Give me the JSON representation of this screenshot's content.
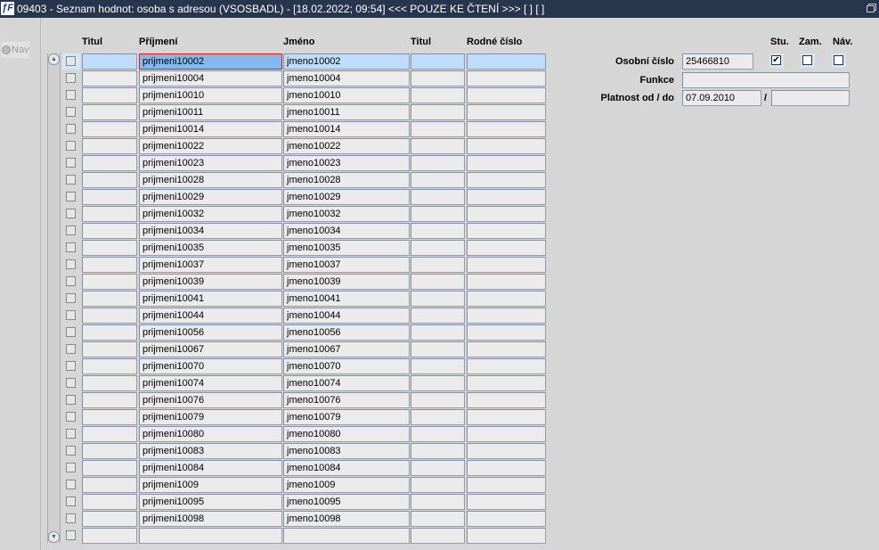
{
  "window": {
    "title": "09403 - Seznam hodnot: osoba s adresou (VSOSBADL) - [18.02.2022; 09:54] <<< POUZE KE ČTENÍ >>>  [ ]  [ ]",
    "logo": "IF"
  },
  "nav": {
    "label": "Nav"
  },
  "table": {
    "headers": [
      "Titul",
      "Příjmení",
      "Jméno",
      "Titul",
      "Rodné číslo"
    ],
    "rows": [
      {
        "prijmeni": "prijmeni10002",
        "jmeno": "jmeno10002"
      },
      {
        "prijmeni": "prijmeni10004",
        "jmeno": "jmeno10004"
      },
      {
        "prijmeni": "prijmeni10010",
        "jmeno": "jmeno10010"
      },
      {
        "prijmeni": "prijmeni10011",
        "jmeno": "jmeno10011"
      },
      {
        "prijmeni": "prijmeni10014",
        "jmeno": "jmeno10014"
      },
      {
        "prijmeni": "prijmeni10022",
        "jmeno": "jmeno10022"
      },
      {
        "prijmeni": "prijmeni10023",
        "jmeno": "jmeno10023"
      },
      {
        "prijmeni": "prijmeni10028",
        "jmeno": "jmeno10028"
      },
      {
        "prijmeni": "prijmeni10029",
        "jmeno": "jmeno10029"
      },
      {
        "prijmeni": "prijmeni10032",
        "jmeno": "jmeno10032"
      },
      {
        "prijmeni": "prijmeni10034",
        "jmeno": "jmeno10034"
      },
      {
        "prijmeni": "prijmeni10035",
        "jmeno": "jmeno10035"
      },
      {
        "prijmeni": "prijmeni10037",
        "jmeno": "jmeno10037"
      },
      {
        "prijmeni": "prijmeni10039",
        "jmeno": "jmeno10039"
      },
      {
        "prijmeni": "prijmeni10041",
        "jmeno": "jmeno10041"
      },
      {
        "prijmeni": "prijmeni10044",
        "jmeno": "jmeno10044"
      },
      {
        "prijmeni": "prijmeni10056",
        "jmeno": "jmeno10056"
      },
      {
        "prijmeni": "prijmeni10067",
        "jmeno": "jmeno10067"
      },
      {
        "prijmeni": "prijmeni10070",
        "jmeno": "jmeno10070"
      },
      {
        "prijmeni": "prijmeni10074",
        "jmeno": "jmeno10074"
      },
      {
        "prijmeni": "prijmeni10076",
        "jmeno": "jmeno10076"
      },
      {
        "prijmeni": "prijmeni10079",
        "jmeno": "jmeno10079"
      },
      {
        "prijmeni": "prijmeni10080",
        "jmeno": "jmeno10080"
      },
      {
        "prijmeni": "prijmeni10083",
        "jmeno": "jmeno10083"
      },
      {
        "prijmeni": "prijmeni10084",
        "jmeno": "jmeno10084"
      },
      {
        "prijmeni": "prijmeni1009",
        "jmeno": "jmeno1009"
      },
      {
        "prijmeni": "prijmeni10095",
        "jmeno": "jmeno10095"
      },
      {
        "prijmeni": "prijmeni10098",
        "jmeno": "jmeno10098"
      },
      {
        "prijmeni": "",
        "jmeno": ""
      }
    ]
  },
  "detail": {
    "osobni_cislo_label": "Osobní číslo",
    "osobni_cislo": "25466810",
    "funkce_label": "Funkce",
    "funkce": "",
    "platnost_label": "Platnost od / do",
    "platnost_od": "07.09.2010",
    "separator": "/",
    "platnost_do": "",
    "flags": [
      {
        "label": "Stu.",
        "checked": true
      },
      {
        "label": "Zam.",
        "checked": false
      },
      {
        "label": "Náv.",
        "checked": false
      }
    ]
  }
}
